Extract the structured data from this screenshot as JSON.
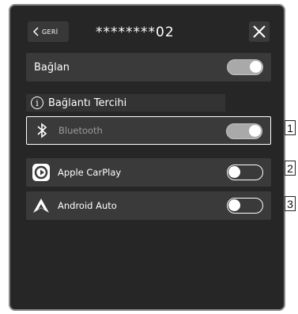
{
  "header": {
    "back_label": "GERİ",
    "device_name": "********02"
  },
  "connect": {
    "label": "Bağlan",
    "enabled": true
  },
  "preference_heading": "Bağlantı Tercihi",
  "options": [
    {
      "label": "Bluetooth",
      "icon": "bluetooth-icon",
      "enabled": true
    },
    {
      "label": "Apple CarPlay",
      "icon": "carplay-icon",
      "enabled": false
    },
    {
      "label": "Android Auto",
      "icon": "android-auto-icon",
      "enabled": false
    }
  ],
  "callouts": [
    "1",
    "2",
    "3"
  ]
}
